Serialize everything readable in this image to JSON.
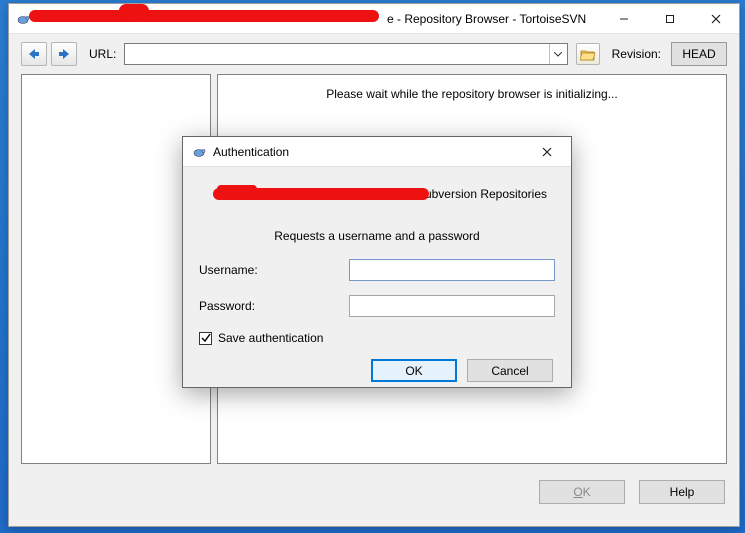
{
  "window": {
    "title_visible_suffix": "e - Repository Browser - TortoiseSVN"
  },
  "toolbar": {
    "url_label": "URL:",
    "url_value": "",
    "revision_label": "Revision:",
    "head_label": "HEAD"
  },
  "main": {
    "loading_message": "Please wait while the repository browser is initializing..."
  },
  "bottom": {
    "ok_label": "OK",
    "help_label": "Help"
  },
  "dialog": {
    "title": "Authentication",
    "repo_suffix": "Subversion Repositories",
    "request_line": "Requests a username and a password",
    "username_label": "Username:",
    "username_value": "",
    "password_label": "Password:",
    "password_value": "",
    "save_auth_label": "Save authentication",
    "save_auth_checked": true,
    "ok_label": "OK",
    "cancel_label": "Cancel"
  },
  "icons": {
    "tortoise": "tortoise-icon",
    "back": "back-arrow-icon",
    "forward": "forward-arrow-icon",
    "dropdown": "chevron-down-icon",
    "folder": "folder-open-icon",
    "minimize": "minimize-icon",
    "maximize": "maximize-icon",
    "close": "close-icon"
  },
  "colors": {
    "accent": "#0078d7",
    "redaction": "#ee1111"
  }
}
